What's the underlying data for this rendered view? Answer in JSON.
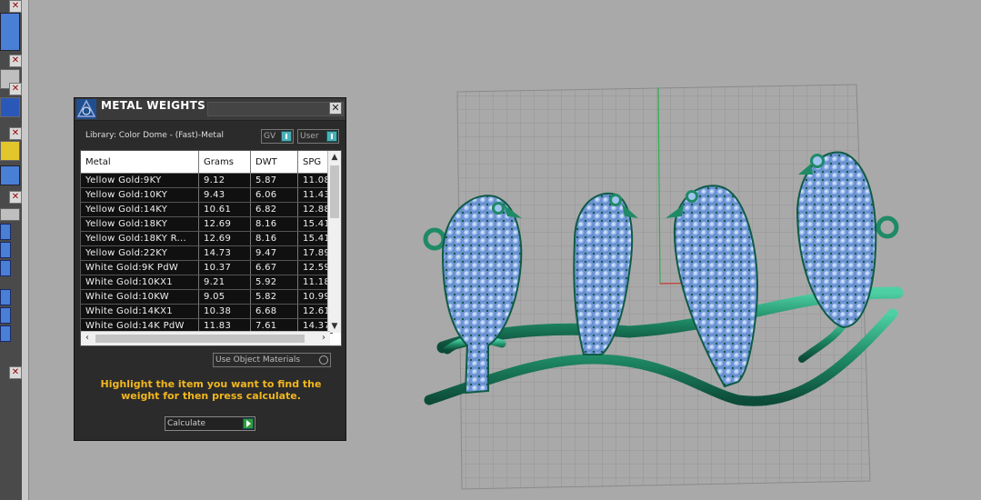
{
  "dialog": {
    "title": "METAL WEIGHTS",
    "library_label": "Library: Color Dome - (Fast)-Metal",
    "gv_label": "GV",
    "user_label": "User",
    "columns": [
      "Metal",
      "Grams",
      "DWT",
      "SPG"
    ],
    "rows": [
      {
        "metal": "Yellow Gold:9KY",
        "grams": "9.12",
        "dwt": "5.87",
        "spg": "11.08"
      },
      {
        "metal": "Yellow Gold:10KY",
        "grams": "9.43",
        "dwt": "6.06",
        "spg": "11.43"
      },
      {
        "metal": "Yellow Gold:14KY",
        "grams": "10.61",
        "dwt": "6.82",
        "spg": "12.88"
      },
      {
        "metal": "Yellow Gold:18KY",
        "grams": "12.69",
        "dwt": "8.16",
        "spg": "15.41"
      },
      {
        "metal": "Yellow Gold:18KY R...",
        "grams": "12.69",
        "dwt": "8.16",
        "spg": "15.41"
      },
      {
        "metal": "Yellow Gold:22KY",
        "grams": "14.73",
        "dwt": "9.47",
        "spg": "17.89"
      },
      {
        "metal": "White Gold:9K PdW",
        "grams": "10.37",
        "dwt": "6.67",
        "spg": "12.59"
      },
      {
        "metal": "White Gold:10KX1",
        "grams": "9.21",
        "dwt": "5.92",
        "spg": "11.18"
      },
      {
        "metal": "White Gold:10KW",
        "grams": "9.05",
        "dwt": "5.82",
        "spg": "10.99"
      },
      {
        "metal": "White Gold:14KX1",
        "grams": "10.38",
        "dwt": "6.68",
        "spg": "12.61"
      },
      {
        "metal": "White Gold:14K PdW",
        "grams": "11.83",
        "dwt": "7.61",
        "spg": "14.37"
      }
    ],
    "use_object_materials": "Use Object Materials",
    "hint": "Highlight the item you want to find the weight for then press calculate.",
    "calculate_label": "Calculate"
  },
  "colors": {
    "background": "#a9a9a9",
    "model_green": "#1f8a66",
    "gem_blue": "#8fb4ea",
    "hint_text": "#f2b71e"
  },
  "icons": [
    "close-icon",
    "app-logo-icon",
    "scroll-up-icon",
    "scroll-down-icon",
    "scroll-left-icon",
    "scroll-right-icon",
    "play-icon"
  ]
}
